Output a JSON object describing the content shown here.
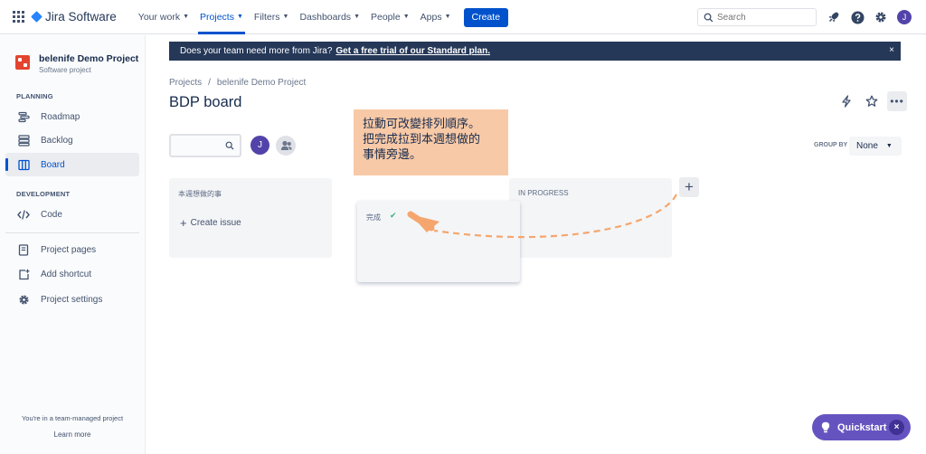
{
  "topnav": {
    "logo": "Jira Software",
    "items": [
      {
        "label": "Your work"
      },
      {
        "label": "Projects"
      },
      {
        "label": "Filters"
      },
      {
        "label": "Dashboards"
      },
      {
        "label": "People"
      },
      {
        "label": "Apps"
      }
    ],
    "active_item": "Projects",
    "create_label": "Create",
    "search_placeholder": "Search",
    "avatar_initial": "J"
  },
  "sidebar": {
    "project_name": "belenife Demo Project",
    "project_type": "Software project",
    "planning_label": "PLANNING",
    "planning_items": [
      {
        "label": "Roadmap",
        "icon": "roadmap-icon"
      },
      {
        "label": "Backlog",
        "icon": "backlog-icon"
      },
      {
        "label": "Board",
        "icon": "board-icon",
        "active": true
      }
    ],
    "development_label": "DEVELOPMENT",
    "development_items": [
      {
        "label": "Code",
        "icon": "code-icon"
      }
    ],
    "other_items": [
      {
        "label": "Project pages",
        "icon": "pages-icon"
      },
      {
        "label": "Add shortcut",
        "icon": "add-shortcut-icon"
      },
      {
        "label": "Project settings",
        "icon": "settings-icon"
      }
    ],
    "team_note": "You're in a team-managed project",
    "learn_more": "Learn more"
  },
  "banner": {
    "text": "Does your team need more from Jira?",
    "link": "Get a free trial of our Standard plan.",
    "close": "×"
  },
  "breadcrumb": {
    "root": "Projects",
    "separator": "/",
    "project": "belenife Demo Project"
  },
  "board": {
    "title": "BDP board",
    "avatar_initial": "J",
    "group_by_label": "GROUP BY",
    "group_by_value": "None",
    "columns": [
      {
        "title": "本週想做的事",
        "create_issue": "Create issue"
      },
      {
        "title": "IN PROGRESS"
      }
    ],
    "dragging_column": {
      "title": "完成"
    },
    "add_column": "+"
  },
  "callout": {
    "lines": [
      "拉動可改變排列順序。",
      "把完成拉到本週想做的",
      "事情旁邊。"
    ],
    "color": "#F8C9A6"
  },
  "arrow": {
    "color": "#F5A66E"
  },
  "quickstart": {
    "label": "Quickstart",
    "close": "×"
  },
  "colors": {
    "primary": "#0052CC",
    "nav_dark": "#253858",
    "quickstart": "#6554C0"
  }
}
